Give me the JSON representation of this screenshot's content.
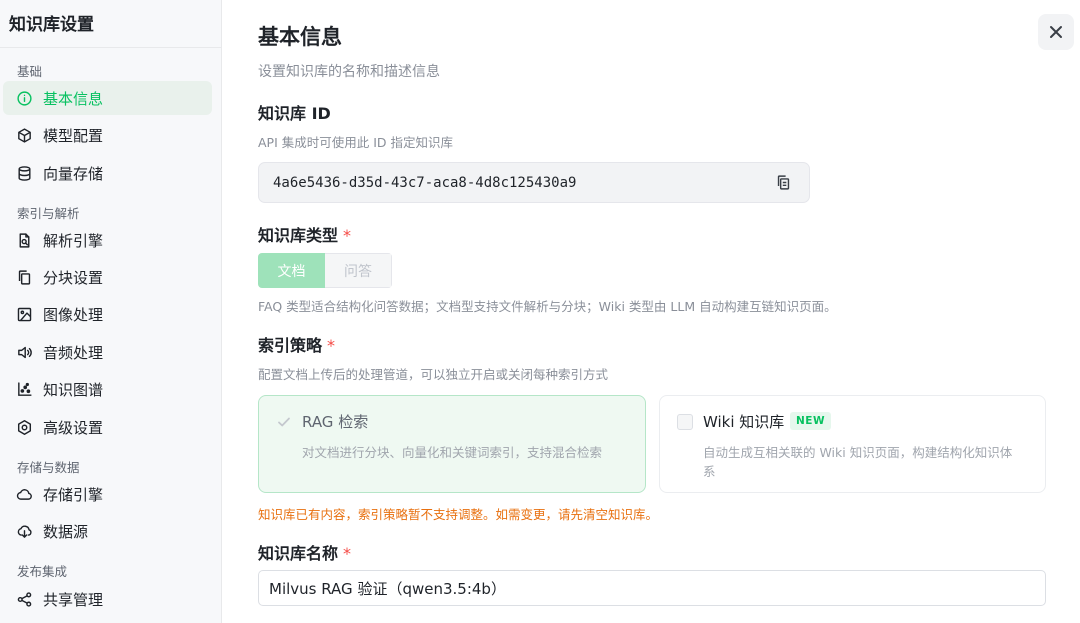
{
  "sidebar": {
    "title": "知识库设置",
    "groups": [
      "基础",
      "索引与解析",
      "存储与数据",
      "发布集成"
    ],
    "items": [
      {
        "label": "基本信息",
        "icon": "info-circle-icon"
      },
      {
        "label": "模型配置",
        "icon": "cube-icon"
      },
      {
        "label": "向量存储",
        "icon": "database-icon"
      },
      {
        "label": "解析引擎",
        "icon": "file-search-icon"
      },
      {
        "label": "分块设置",
        "icon": "copy-pages-icon"
      },
      {
        "label": "图像处理",
        "icon": "image-icon"
      },
      {
        "label": "音频处理",
        "icon": "volume-icon"
      },
      {
        "label": "知识图谱",
        "icon": "graph-icon"
      },
      {
        "label": "高级设置",
        "icon": "gear-hexagon-icon"
      },
      {
        "label": "存储引擎",
        "icon": "cloud-icon"
      },
      {
        "label": "数据源",
        "icon": "cloud-download-icon"
      },
      {
        "label": "共享管理",
        "icon": "share-icon"
      }
    ]
  },
  "header": {
    "title": "基本信息",
    "subtitle": "设置知识库的名称和描述信息"
  },
  "kb_id": {
    "label": "知识库 ID",
    "help": "API 集成时可使用此 ID 指定知识库",
    "value": "4a6e5436-d35d-43c7-aca8-4d8c125430a9"
  },
  "kb_type": {
    "label": "知识库类型",
    "required": "*",
    "options": [
      "文档",
      "问答"
    ],
    "selected": "文档",
    "help": "FAQ 类型适合结构化问答数据；文档型支持文件解析与分块；Wiki 类型由 LLM 自动构建互链知识页面。"
  },
  "index_strategy": {
    "label": "索引策略",
    "required": "*",
    "help": "配置文档上传后的处理管道，可以独立开启或关闭每种索引方式",
    "rag": {
      "title": "RAG 检索",
      "desc": "对文档进行分块、向量化和关键词索引，支持混合检索",
      "checked": true
    },
    "wiki": {
      "title": "Wiki 知识库",
      "badge": "NEW",
      "desc_line1": "自动生成互相关联的 Wiki 知识页面，构建结构化知识体",
      "desc_line2": "系",
      "checked": false
    },
    "warning": "知识库已有内容，索引策略暂不支持调整。如需变更，请先清空知识库。"
  },
  "kb_name": {
    "label": "知识库名称",
    "required": "*",
    "value": "Milvus RAG 验证（qwen3.5:4b）"
  },
  "colors": {
    "accent": "#07c160",
    "danger": "#f54a45",
    "warning": "#e8700f"
  }
}
